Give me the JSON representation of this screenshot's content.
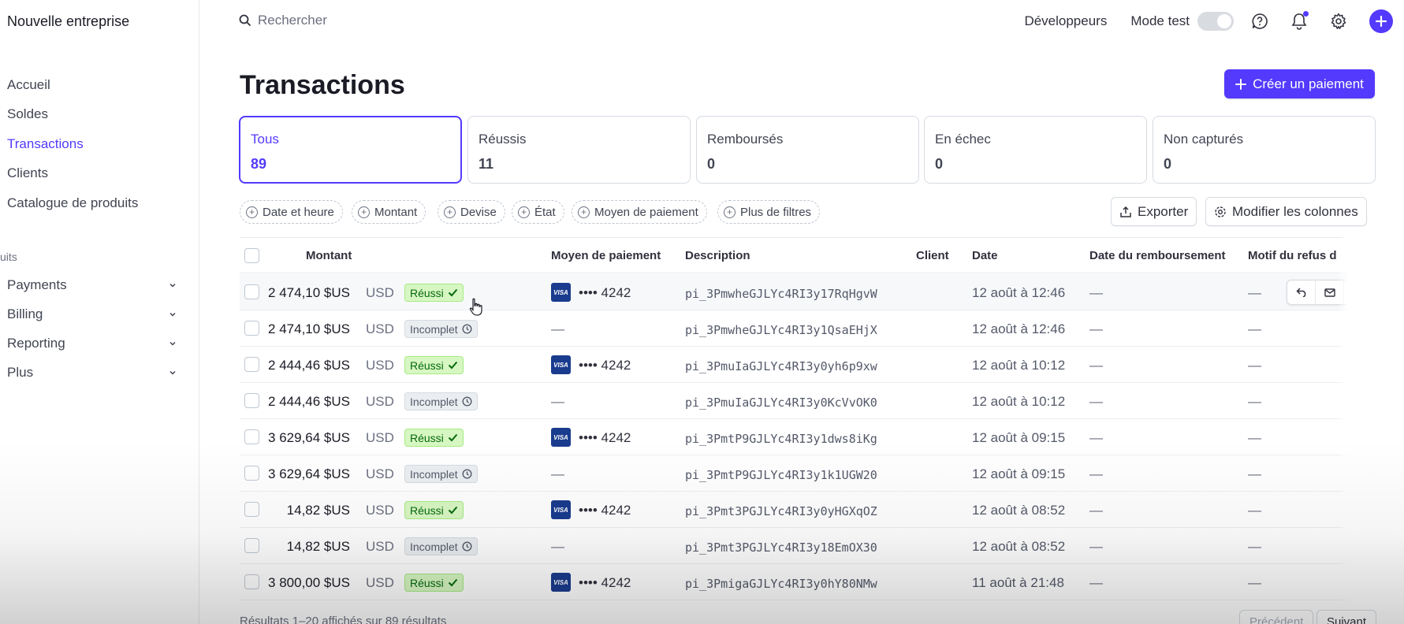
{
  "sidebar": {
    "company": "Nouvelle entreprise",
    "nav": [
      "Accueil",
      "Soldes",
      "Transactions",
      "Clients",
      "Catalogue de produits"
    ],
    "active_index": 2,
    "section_label": "uits",
    "expandables": [
      "Payments",
      "Billing",
      "Reporting",
      "Plus"
    ]
  },
  "topbar": {
    "search_placeholder": "Rechercher",
    "developers": "Développeurs",
    "test_mode": "Mode test",
    "icons": [
      "help-icon",
      "bell-icon",
      "gear-icon",
      "plus-icon"
    ]
  },
  "page": {
    "title": "Transactions",
    "create_button": "Créer un paiement"
  },
  "tabs": [
    {
      "label": "Tous",
      "count": "89"
    },
    {
      "label": "Réussis",
      "count": "11"
    },
    {
      "label": "Remboursés",
      "count": "0"
    },
    {
      "label": "En échec",
      "count": "0"
    },
    {
      "label": "Non capturés",
      "count": "0"
    }
  ],
  "filters": [
    "Date et heure",
    "Montant",
    "Devise",
    "État",
    "Moyen de paiement",
    "Plus de filtres"
  ],
  "toolbar": {
    "export": "Exporter",
    "edit_columns": "Modifier les colonnes"
  },
  "table": {
    "columns": [
      "Montant",
      "Moyen de paiement",
      "Description",
      "Client",
      "Date",
      "Date du remboursement",
      "Motif du refus d"
    ],
    "rows": [
      {
        "amount": "2 474,10 $US",
        "currency": "USD",
        "status": "Réussi",
        "status_type": "ok",
        "card": "•••• 4242",
        "description": "pi_3PmwheGJLYc4RI3y17RqHgvW",
        "date": "12 août à 12:46",
        "refund": "—",
        "reason": "—"
      },
      {
        "amount": "2 474,10 $US",
        "currency": "USD",
        "status": "Incomplet",
        "status_type": "inc",
        "card": "—",
        "description": "pi_3PmwheGJLYc4RI3y1QsaEHjX",
        "date": "12 août à 12:46",
        "refund": "—",
        "reason": "—"
      },
      {
        "amount": "2 444,46 $US",
        "currency": "USD",
        "status": "Réussi",
        "status_type": "ok",
        "card": "•••• 4242",
        "description": "pi_3PmuIaGJLYc4RI3y0yh6p9xw",
        "date": "12 août à 10:12",
        "refund": "—",
        "reason": "—"
      },
      {
        "amount": "2 444,46 $US",
        "currency": "USD",
        "status": "Incomplet",
        "status_type": "inc",
        "card": "—",
        "description": "pi_3PmuIaGJLYc4RI3y0KcVvOK0",
        "date": "12 août à 10:12",
        "refund": "—",
        "reason": "—"
      },
      {
        "amount": "3 629,64 $US",
        "currency": "USD",
        "status": "Réussi",
        "status_type": "ok",
        "card": "•••• 4242",
        "description": "pi_3PmtP9GJLYc4RI3y1dws8iKg",
        "date": "12 août à 09:15",
        "refund": "—",
        "reason": "—"
      },
      {
        "amount": "3 629,64 $US",
        "currency": "USD",
        "status": "Incomplet",
        "status_type": "inc",
        "card": "—",
        "description": "pi_3PmtP9GJLYc4RI3y1k1UGW20",
        "date": "12 août à 09:15",
        "refund": "—",
        "reason": "—"
      },
      {
        "amount": "14,82 $US",
        "currency": "USD",
        "status": "Réussi",
        "status_type": "ok",
        "card": "•••• 4242",
        "description": "pi_3Pmt3PGJLYc4RI3y0yHGXqOZ",
        "date": "12 août à 08:52",
        "refund": "—",
        "reason": "—"
      },
      {
        "amount": "14,82 $US",
        "currency": "USD",
        "status": "Incomplet",
        "status_type": "inc",
        "card": "—",
        "description": "pi_3Pmt3PGJLYc4RI3y18EmOX30",
        "date": "12 août à 08:52",
        "refund": "—",
        "reason": "—"
      },
      {
        "amount": "3 800,00 $US",
        "currency": "USD",
        "status": "Réussi",
        "status_type": "ok",
        "card": "•••• 4242",
        "description": "pi_3PmigaGJLYc4RI3y0hY80NMw",
        "date": "11 août à 21:48",
        "refund": "—",
        "reason": "—"
      }
    ]
  },
  "footer": {
    "summary": "Résultats 1–20 affichés sur 89 résultats",
    "prev": "Précédent",
    "next": "Suivant"
  },
  "colors": {
    "accent": "#533afd",
    "success_bg": "#d7f7c2",
    "success_text": "#05690d"
  }
}
